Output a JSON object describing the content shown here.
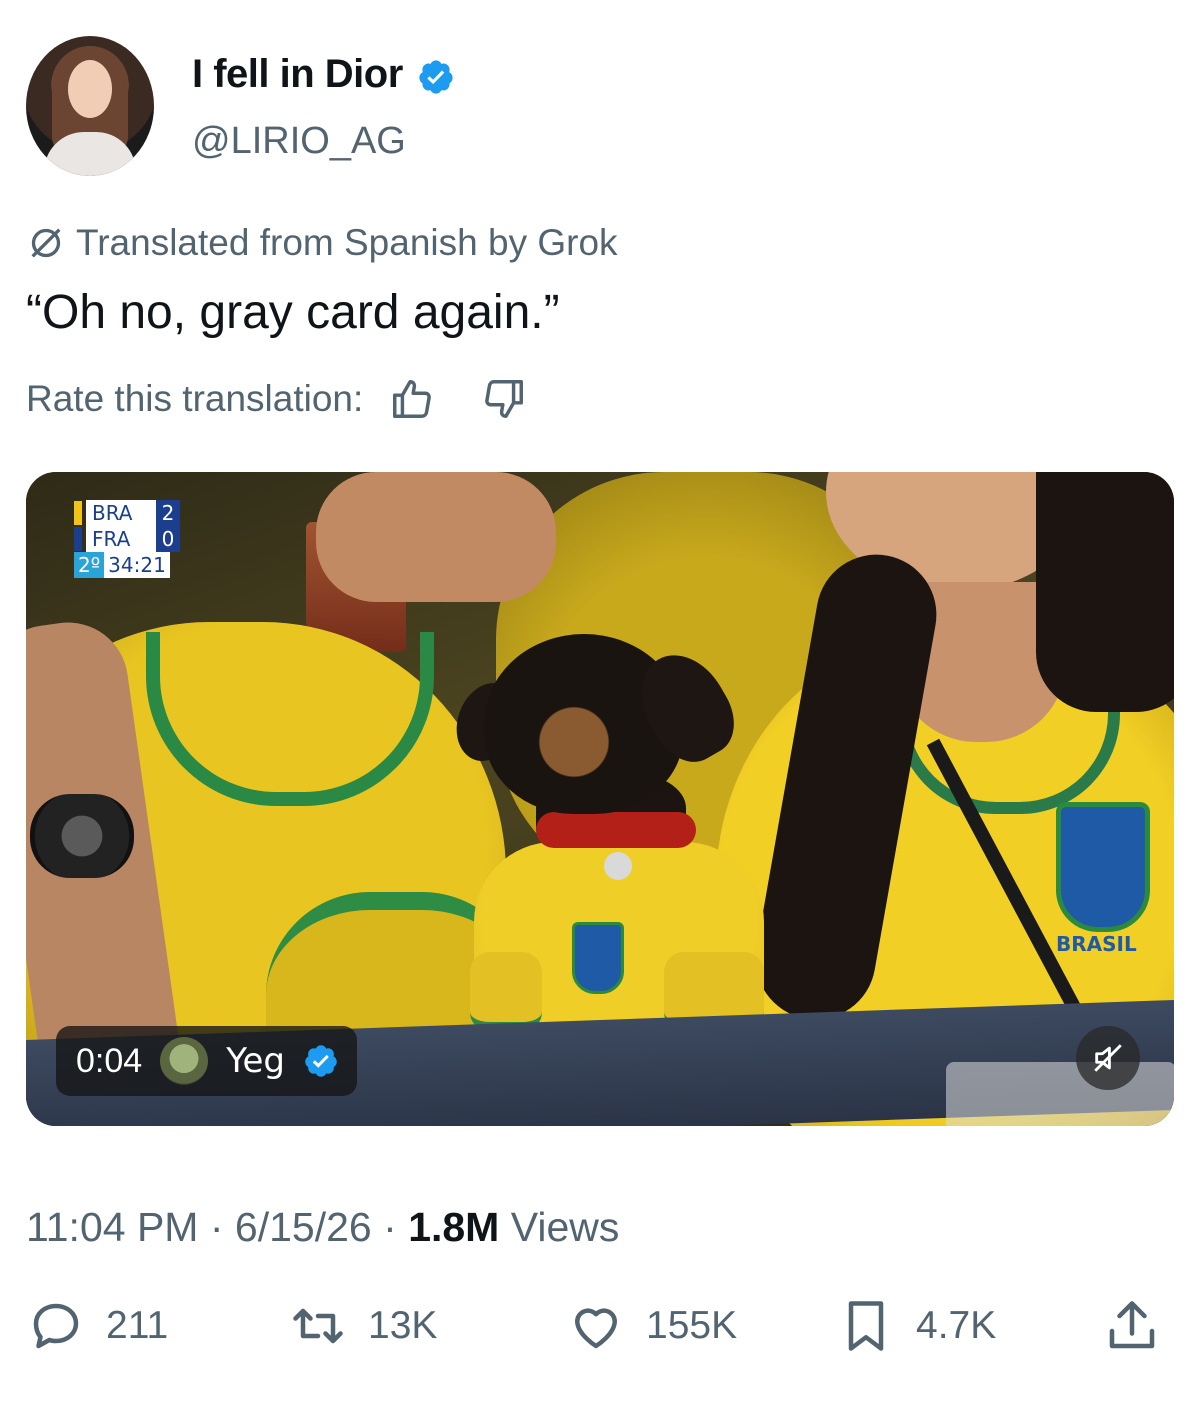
{
  "author": {
    "display_name": "I fell in Dior",
    "handle": "@LIRIO_AG",
    "verified": true,
    "avatar_icon": "user-avatar"
  },
  "translation": {
    "notice": "Translated from Spanish by Grok",
    "notice_icon": "translate-icon",
    "rate_label": "Rate this translation:",
    "thumbs_up_icon": "thumbs-up-icon",
    "thumbs_down_icon": "thumbs-down-icon"
  },
  "tweet": {
    "text": "“Oh no, gray card again.”"
  },
  "media": {
    "scoreboard": {
      "teams": [
        {
          "name": "BRA",
          "score": "2"
        },
        {
          "name": "FRA",
          "score": "0"
        }
      ],
      "period": "2º",
      "clock": "34:21"
    },
    "jersey_crest": "CBF",
    "jersey_text": "BRASIL",
    "video_time": "0:04",
    "video_user": "Yeg",
    "mute_icon": "mute-icon"
  },
  "meta": {
    "time": "11:04 PM",
    "separator": "·",
    "date": "6/15/26",
    "views_count": "1.8M",
    "views_label": "Views"
  },
  "actions": {
    "replies": "211",
    "reposts": "13K",
    "likes": "155K",
    "bookmarks": "4.7K"
  },
  "colors": {
    "verified_blue": "#1d9bf0",
    "secondary_text": "#536471",
    "primary_text": "#0f1419"
  }
}
